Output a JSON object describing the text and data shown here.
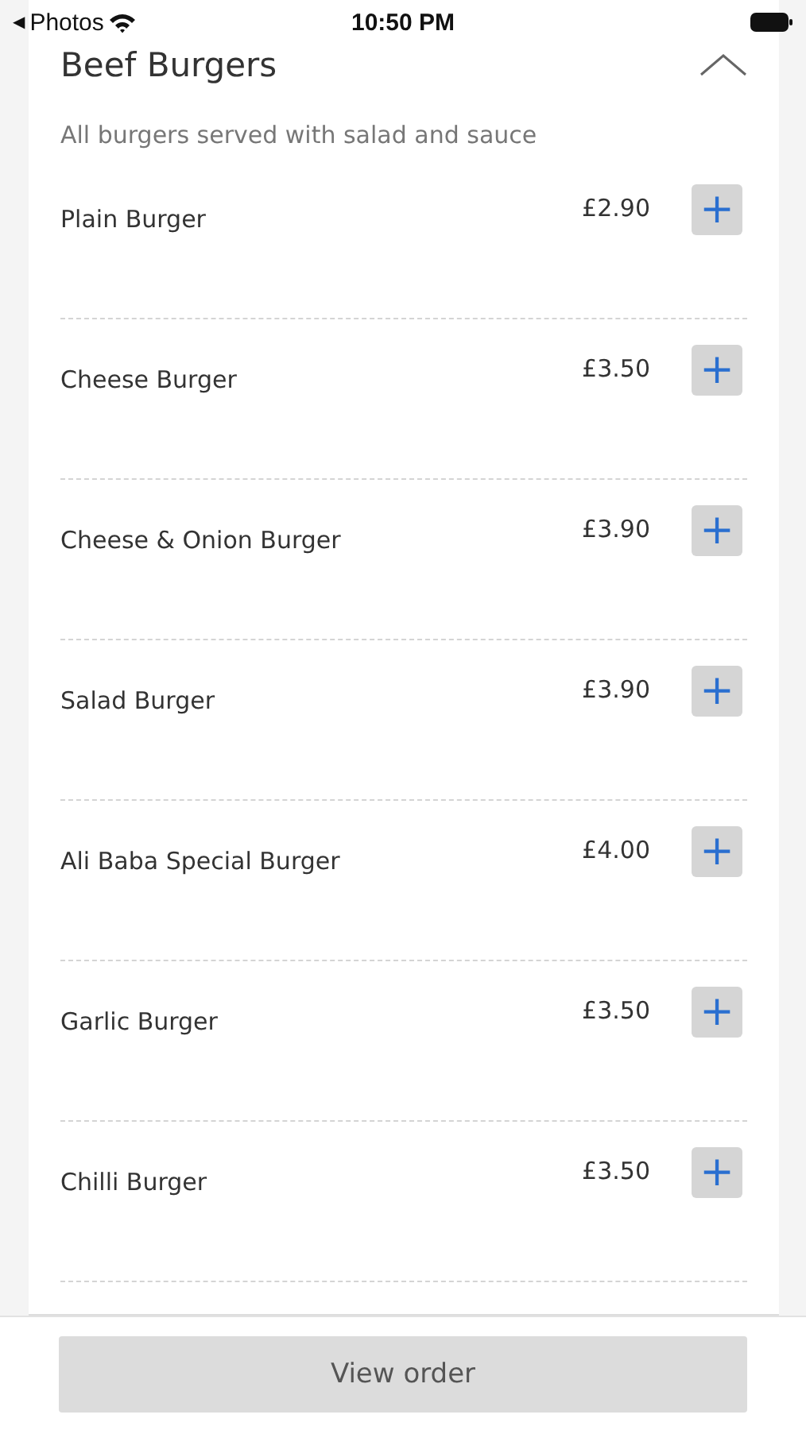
{
  "status_bar": {
    "back_glyph": "◀",
    "back_label": "Photos",
    "time": "10:50 PM"
  },
  "section": {
    "title": "Beef Burgers",
    "expanded": true,
    "note": "All burgers served with salad and sauce",
    "items": [
      {
        "name": "Plain Burger",
        "price": "£2.90",
        "add": "+"
      },
      {
        "name": "Cheese Burger",
        "price": "£3.50",
        "add": "+"
      },
      {
        "name": "Cheese & Onion Burger",
        "price": "£3.90",
        "add": "+"
      },
      {
        "name": "Salad Burger",
        "price": "£3.90",
        "add": "+"
      },
      {
        "name": "Ali Baba Special Burger",
        "price": "£4.00",
        "add": "+"
      },
      {
        "name": "Garlic Burger",
        "price": "£3.50",
        "add": "+"
      },
      {
        "name": "Chilli Burger",
        "price": "£3.50",
        "add": "+"
      }
    ]
  },
  "footer_button": "View order"
}
